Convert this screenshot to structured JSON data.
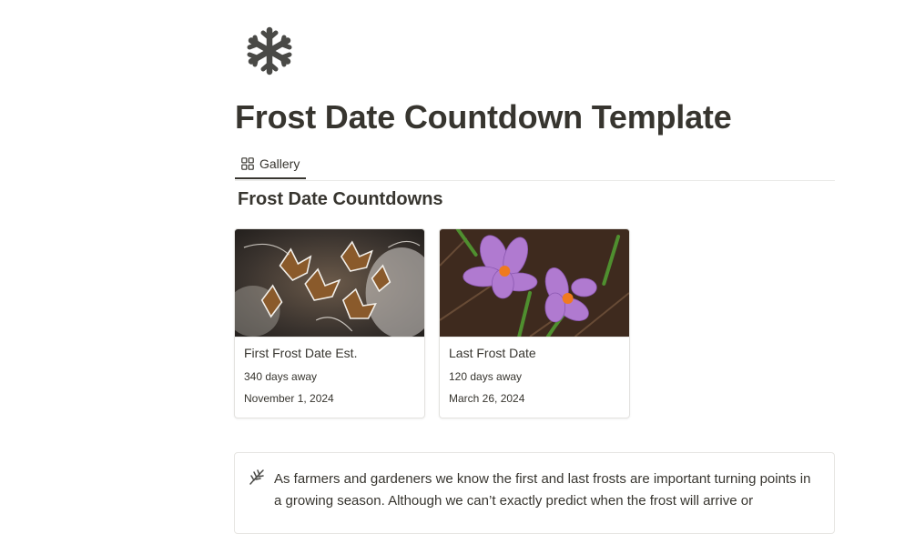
{
  "page": {
    "icon": "snowflake-icon",
    "title": "Frost Date Countdown Template"
  },
  "view_tabs": [
    {
      "icon": "gallery-grid-icon",
      "label": "Gallery"
    }
  ],
  "database": {
    "title": "Frost Date Countdowns",
    "cards": [
      {
        "cover": "frosted-leaves-photo",
        "title": "First Frost Date Est.",
        "countdown": "340 days away",
        "date": "November 1, 2024"
      },
      {
        "cover": "purple-crocus-photo",
        "title": "Last Frost Date",
        "countdown": "120 days away",
        "date": "March 26, 2024"
      }
    ]
  },
  "callout": {
    "icon": "sprout-branch-icon",
    "text": "As farmers and gardeners we know the first and last frosts are important turning points in a growing season. Although we can’t exactly predict when the frost will arrive or"
  },
  "colors": {
    "text": "#37352f",
    "icon": "#4a4a47",
    "border": "#e3e2df"
  }
}
